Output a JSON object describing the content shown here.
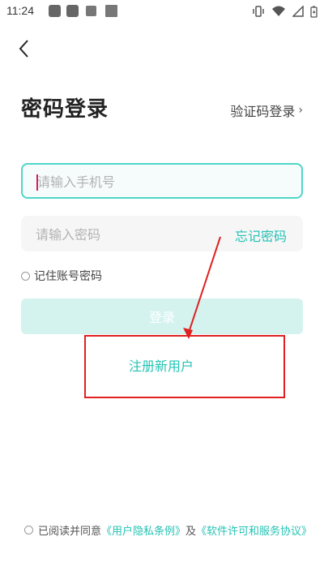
{
  "status_bar": {
    "time": "11:24"
  },
  "nav": {
    "back_label": ""
  },
  "header": {
    "title": "密码登录",
    "sms_login": "验证码登录",
    "sms_chevron": "›"
  },
  "form": {
    "phone_placeholder": "请输入手机号",
    "password_placeholder": "请输入密码",
    "forgot_password": "忘记密码",
    "remember_me": "记住账号密码",
    "login_button": "登录",
    "register": "注册新用户"
  },
  "agreement": {
    "prefix": "已阅读并同意",
    "privacy_link": "《用户隐私条例》",
    "and": "及",
    "license_link": "《软件许可和服务协议》"
  },
  "colors": {
    "accent": "#24c3b4",
    "annotation": "#e02020",
    "login_disabled": "#d4f3ef"
  }
}
